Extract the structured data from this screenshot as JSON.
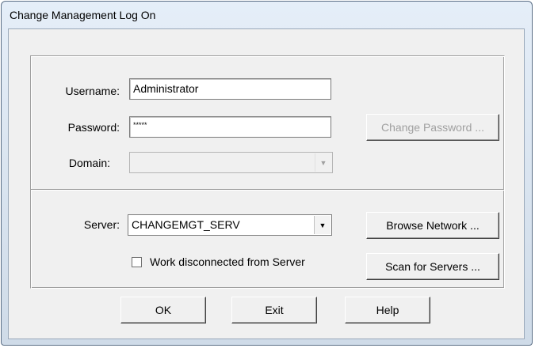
{
  "window": {
    "title": "Change Management Log On"
  },
  "form": {
    "username_label": "Username:",
    "username_value": "Administrator",
    "password_label": "Password:",
    "password_value": "*****",
    "domain_label": "Domain:",
    "domain_value": "",
    "change_password_label": "Change Password ...",
    "server_label": "Server:",
    "server_value": "CHANGEMGT_SERV",
    "browse_network_label": "Browse Network ...",
    "work_disconnected_label": "Work disconnected from Server",
    "work_disconnected_checked": false,
    "scan_servers_label": "Scan for Servers ..."
  },
  "buttons": {
    "ok": "OK",
    "exit": "Exit",
    "help": "Help"
  },
  "icons": {
    "dropdown": "chevron-down-icon"
  }
}
